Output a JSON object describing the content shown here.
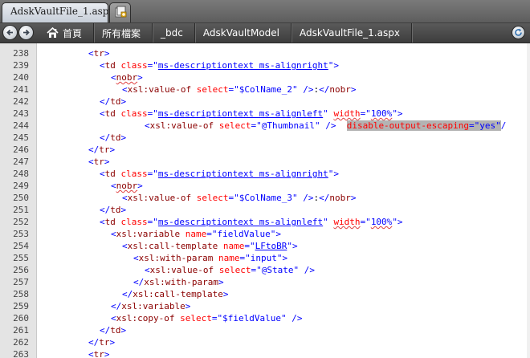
{
  "tabs": {
    "active_label": "AdskVaultFile_1.aspx *",
    "new_tab_icon": "new-tab-icon"
  },
  "breadcrumb": {
    "home_label": "首頁",
    "items": [
      "所有檔案",
      "_bdc",
      "AdskVaultModel",
      "AdskVaultFile_1.aspx"
    ]
  },
  "editor": {
    "lines": [
      {
        "num": "238",
        "indent": 1,
        "tokens": [
          [
            "br",
            "<"
          ],
          [
            "tg",
            "tr"
          ],
          [
            "br",
            ">"
          ]
        ]
      },
      {
        "num": "239",
        "indent": 2,
        "tokens": [
          [
            "br",
            "<"
          ],
          [
            "tg",
            "td "
          ],
          [
            "at",
            "class"
          ],
          [
            "br",
            "=\""
          ],
          [
            "vl",
            "ms-descriptiontext ms-alignright",
            "und"
          ],
          [
            "br",
            "\">"
          ]
        ]
      },
      {
        "num": "240",
        "indent": 3,
        "tokens": [
          [
            "br",
            "<"
          ],
          [
            "tg",
            "nobr",
            "squig"
          ],
          [
            "br",
            ">"
          ]
        ]
      },
      {
        "num": "241",
        "indent": 4,
        "tokens": [
          [
            "br",
            "<"
          ],
          [
            "tg",
            "xsl:value-of "
          ],
          [
            "at",
            "select"
          ],
          [
            "br",
            "=\""
          ],
          [
            "vl",
            "$ColName_2"
          ],
          [
            "br",
            "\" />"
          ],
          [
            "tx",
            ":"
          ],
          [
            "br",
            "</"
          ],
          [
            "tg",
            "nobr"
          ],
          [
            "br",
            ">"
          ]
        ]
      },
      {
        "num": "242",
        "indent": 2,
        "tokens": [
          [
            "br",
            "</"
          ],
          [
            "tg",
            "td"
          ],
          [
            "br",
            ">"
          ]
        ]
      },
      {
        "num": "243",
        "indent": 2,
        "tokens": [
          [
            "br",
            "<"
          ],
          [
            "tg",
            "td "
          ],
          [
            "at",
            "class"
          ],
          [
            "br",
            "=\""
          ],
          [
            "vl",
            "ms-descriptiontext ms-alignleft",
            "und"
          ],
          [
            "br",
            "\" "
          ],
          [
            "at",
            "width",
            "squig"
          ],
          [
            "br",
            "=\""
          ],
          [
            "vl",
            "100%",
            "squig"
          ],
          [
            "br",
            "\">"
          ]
        ]
      },
      {
        "num": "244",
        "indent": 6,
        "tokens": [
          [
            "br",
            "<"
          ],
          [
            "tg",
            "xsl:value-of "
          ],
          [
            "at",
            "select"
          ],
          [
            "br",
            "=\""
          ],
          [
            "vl",
            "@Thumbnail"
          ],
          [
            "br",
            "\" />  "
          ],
          [
            "at",
            "disable-output-escaping",
            "sel"
          ],
          [
            "br",
            "=\"",
            "sel"
          ],
          [
            "vl",
            "yes",
            "sel"
          ],
          [
            "br",
            "\"",
            "sel"
          ],
          [
            "br",
            "/"
          ]
        ]
      },
      {
        "num": "245",
        "indent": 2,
        "tokens": [
          [
            "br",
            "</"
          ],
          [
            "tg",
            "td"
          ],
          [
            "br",
            ">"
          ]
        ]
      },
      {
        "num": "246",
        "indent": 1,
        "tokens": [
          [
            "br",
            "</"
          ],
          [
            "tg",
            "tr"
          ],
          [
            "br",
            ">"
          ]
        ]
      },
      {
        "num": "247",
        "indent": 1,
        "tokens": [
          [
            "br",
            "<"
          ],
          [
            "tg",
            "tr"
          ],
          [
            "br",
            ">"
          ]
        ]
      },
      {
        "num": "248",
        "indent": 2,
        "tokens": [
          [
            "br",
            "<"
          ],
          [
            "tg",
            "td "
          ],
          [
            "at",
            "class"
          ],
          [
            "br",
            "=\""
          ],
          [
            "vl",
            "ms-descriptiontext ms-alignright",
            "und"
          ],
          [
            "br",
            "\">"
          ]
        ]
      },
      {
        "num": "249",
        "indent": 3,
        "tokens": [
          [
            "br",
            "<"
          ],
          [
            "tg",
            "nobr",
            "squig"
          ],
          [
            "br",
            ">"
          ]
        ]
      },
      {
        "num": "250",
        "indent": 4,
        "tokens": [
          [
            "br",
            "<"
          ],
          [
            "tg",
            "xsl:value-of "
          ],
          [
            "at",
            "select"
          ],
          [
            "br",
            "=\""
          ],
          [
            "vl",
            "$ColName_3"
          ],
          [
            "br",
            "\" />"
          ],
          [
            "tx",
            ":"
          ],
          [
            "br",
            "</"
          ],
          [
            "tg",
            "nobr"
          ],
          [
            "br",
            ">"
          ]
        ]
      },
      {
        "num": "251",
        "indent": 2,
        "tokens": [
          [
            "br",
            "</"
          ],
          [
            "tg",
            "td"
          ],
          [
            "br",
            ">"
          ]
        ]
      },
      {
        "num": "252",
        "indent": 2,
        "tokens": [
          [
            "br",
            "<"
          ],
          [
            "tg",
            "td "
          ],
          [
            "at",
            "class"
          ],
          [
            "br",
            "=\""
          ],
          [
            "vl",
            "ms-descriptiontext ms-alignleft",
            "und"
          ],
          [
            "br",
            "\" "
          ],
          [
            "at",
            "width",
            "squig"
          ],
          [
            "br",
            "=\""
          ],
          [
            "vl",
            "100%",
            "squig"
          ],
          [
            "br",
            "\">"
          ]
        ]
      },
      {
        "num": "253",
        "indent": 3,
        "tokens": [
          [
            "br",
            "<"
          ],
          [
            "tg",
            "xsl:variable "
          ],
          [
            "at",
            "name"
          ],
          [
            "br",
            "=\""
          ],
          [
            "vl",
            "fieldValue"
          ],
          [
            "br",
            "\">"
          ]
        ]
      },
      {
        "num": "254",
        "indent": 4,
        "tokens": [
          [
            "br",
            "<"
          ],
          [
            "tg",
            "xsl:call-template "
          ],
          [
            "at",
            "name"
          ],
          [
            "br",
            "=\""
          ],
          [
            "vl",
            "LFtoBR",
            "und"
          ],
          [
            "br",
            "\">"
          ]
        ]
      },
      {
        "num": "255",
        "indent": 5,
        "tokens": [
          [
            "br",
            "<"
          ],
          [
            "tg",
            "xsl:with-param "
          ],
          [
            "at",
            "name"
          ],
          [
            "br",
            "=\""
          ],
          [
            "vl",
            "input"
          ],
          [
            "br",
            "\">"
          ]
        ]
      },
      {
        "num": "256",
        "indent": 6,
        "tokens": [
          [
            "br",
            "<"
          ],
          [
            "tg",
            "xsl:value-of "
          ],
          [
            "at",
            "select"
          ],
          [
            "br",
            "=\""
          ],
          [
            "vl",
            "@State"
          ],
          [
            "br",
            "\" />"
          ]
        ]
      },
      {
        "num": "257",
        "indent": 5,
        "tokens": [
          [
            "br",
            "</"
          ],
          [
            "tg",
            "xsl:with-param"
          ],
          [
            "br",
            ">"
          ]
        ]
      },
      {
        "num": "258",
        "indent": 4,
        "tokens": [
          [
            "br",
            "</"
          ],
          [
            "tg",
            "xsl:call-template"
          ],
          [
            "br",
            ">"
          ]
        ]
      },
      {
        "num": "259",
        "indent": 3,
        "tokens": [
          [
            "br",
            "</"
          ],
          [
            "tg",
            "xsl:variable"
          ],
          [
            "br",
            ">"
          ]
        ]
      },
      {
        "num": "260",
        "indent": 3,
        "tokens": [
          [
            "br",
            "<"
          ],
          [
            "tg",
            "xsl:copy-of "
          ],
          [
            "at",
            "select"
          ],
          [
            "br",
            "=\""
          ],
          [
            "vl",
            "$fieldValue"
          ],
          [
            "br",
            "\" />"
          ]
        ]
      },
      {
        "num": "261",
        "indent": 2,
        "tokens": [
          [
            "br",
            "</"
          ],
          [
            "tg",
            "td"
          ],
          [
            "br",
            ">"
          ]
        ]
      },
      {
        "num": "262",
        "indent": 1,
        "tokens": [
          [
            "br",
            "</"
          ],
          [
            "tg",
            "tr"
          ],
          [
            "br",
            ">"
          ]
        ]
      },
      {
        "num": "263",
        "indent": 1,
        "tokens": [
          [
            "br",
            "<"
          ],
          [
            "tg",
            "tr"
          ],
          [
            "br",
            ">"
          ]
        ]
      }
    ]
  },
  "colors": {
    "tag": "#8b0000",
    "attribute": "#ff0000",
    "value": "#0000ff",
    "bracket": "#0000ff",
    "selection": "#b3b3b3"
  }
}
